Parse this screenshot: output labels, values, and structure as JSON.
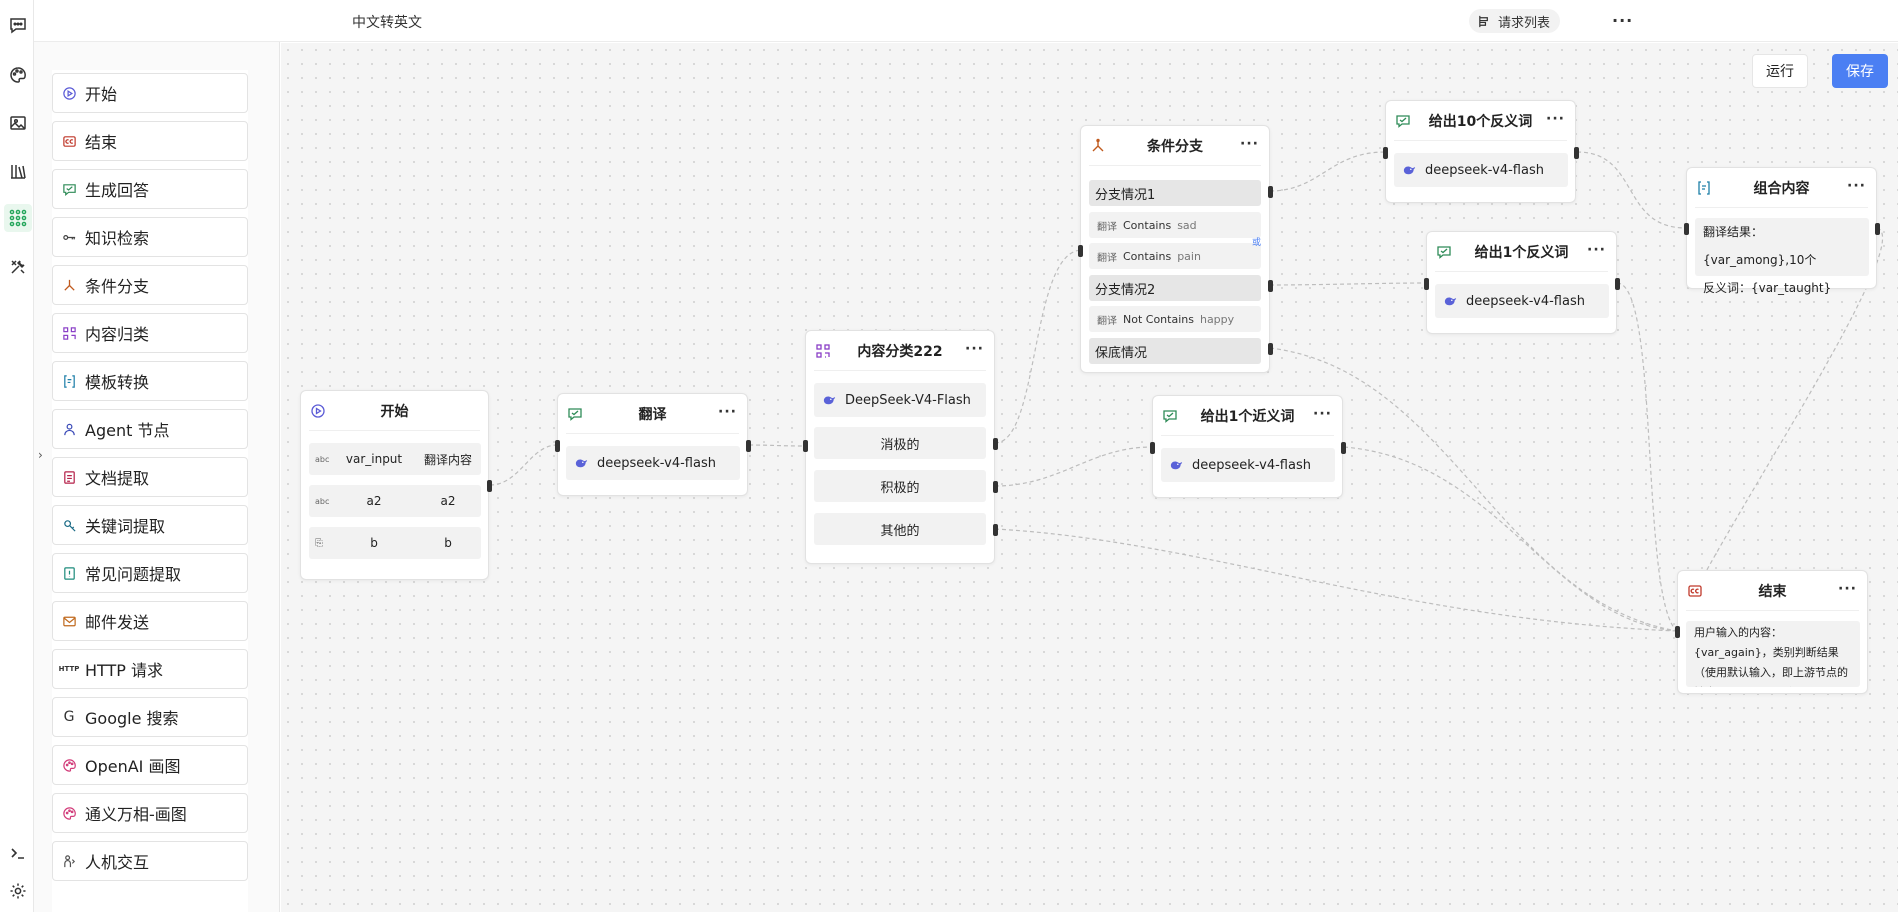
{
  "document_title": "中文转英文",
  "header": {
    "request_list_label": "请求列表",
    "more_label": "···"
  },
  "actions": {
    "run_label": "运行",
    "save_label": "保存"
  },
  "palette": {
    "items": [
      {
        "label": "开始",
        "icon": "play-circle-icon"
      },
      {
        "label": "结束",
        "icon": "cc-icon"
      },
      {
        "label": "生成回答",
        "icon": "chat-icon"
      },
      {
        "label": "知识检索",
        "icon": "key-icon"
      },
      {
        "label": "条件分支",
        "icon": "branch-icon"
      },
      {
        "label": "内容归类",
        "icon": "qr-icon"
      },
      {
        "label": "模板转换",
        "icon": "template-icon"
      },
      {
        "label": "Agent 节点",
        "icon": "agent-icon"
      },
      {
        "label": "文档提取",
        "icon": "doc-icon"
      },
      {
        "label": "关键词提取",
        "icon": "keyword-icon"
      },
      {
        "label": "常见问题提取",
        "icon": "faq-icon"
      },
      {
        "label": "邮件发送",
        "icon": "mail-icon"
      },
      {
        "label": "HTTP 请求",
        "icon": "http-icon"
      },
      {
        "label": "Google 搜索",
        "icon": "google-icon"
      },
      {
        "label": "OpenAI 画图",
        "icon": "palette-icon"
      },
      {
        "label": "通义万相-画图",
        "icon": "palette-icon"
      },
      {
        "label": "人机交互",
        "icon": "human-icon"
      }
    ],
    "http_tag": "HTTP",
    "google_tag": "G"
  },
  "nodes": {
    "start": {
      "title": "开始",
      "rows": [
        {
          "type": "abc",
          "name": "var_input",
          "value": "翻译内容"
        },
        {
          "type": "abc",
          "name": "a2",
          "value": "a2"
        },
        {
          "type": "file",
          "name": "b",
          "value": "b"
        }
      ]
    },
    "translate": {
      "title": "翻译",
      "model": "deepseek-v4-flash"
    },
    "classify": {
      "title": "内容分类222",
      "model": "DeepSeek-V4-Flash",
      "classes": [
        "消极的",
        "积极的",
        "其他的"
      ]
    },
    "branch": {
      "title": "条件分支",
      "case1": "分支情况1",
      "case1_conditions": [
        {
          "tag": "翻译",
          "op": "Contains",
          "value": "sad"
        },
        {
          "tag": "翻译",
          "op": "Contains",
          "value": "pain"
        }
      ],
      "or_label": "或",
      "case2": "分支情况2",
      "case2_conditions": [
        {
          "tag": "翻译",
          "op": "Not Contains",
          "value": "happy"
        }
      ],
      "fallback": "保底情况"
    },
    "antonym10": {
      "title": "给出10个反义词",
      "model": "deepseek-v4-flash"
    },
    "antonym1": {
      "title": "给出1个反义词",
      "model": "deepseek-v4-flash"
    },
    "synonym1": {
      "title": "给出1个近义词",
      "model": "deepseek-v4-flash"
    },
    "combine": {
      "title": "组合内容",
      "line1": "翻译结果：{var_among},10个",
      "line2": "反义词：{var_taught}"
    },
    "end": {
      "title": "结束",
      "text": "用户输入的内容：{var_again}，类别判断结果（使用默认输入，即上游节点的输出）：{input}，翻译..."
    }
  },
  "colors": {
    "accent_blue": "#4b7ff3",
    "rail_active": "#22a55a",
    "edge": "#bdbdbd"
  }
}
